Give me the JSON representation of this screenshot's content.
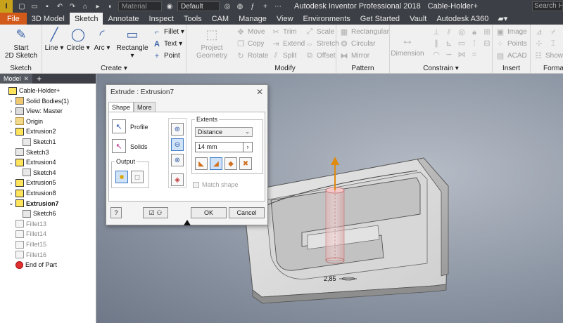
{
  "titlebar": {
    "logo": "I",
    "material_placeholder": "Material",
    "appearance_value": "Default",
    "title": "Autodesk Inventor Professional 2018",
    "document": "Cable-Holder+",
    "search_placeholder": "Search Help"
  },
  "tabs": [
    "File",
    "3D Model",
    "Sketch",
    "Annotate",
    "Inspect",
    "Tools",
    "CAM",
    "Manage",
    "View",
    "Environments",
    "Get Started",
    "Vault",
    "Autodesk A360"
  ],
  "active_tab": "Sketch",
  "ribbon": {
    "sketch_group": {
      "start_label": "Start\n2D Sketch",
      "group_label": "Sketch"
    },
    "create_group": {
      "line": "Line",
      "circle": "Circle",
      "arc": "Arc",
      "rectangle": "Rectangle",
      "fillet": "Fillet",
      "text": "Text",
      "point": "Point",
      "group_label": "Create"
    },
    "project_geometry": "Project\nGeometry",
    "modify_group": {
      "move": "Move",
      "copy": "Copy",
      "rotate": "Rotate",
      "trim": "Trim",
      "extend": "Extend",
      "split": "Split",
      "scale": "Scale",
      "stretch": "Stretch",
      "offset": "Offset",
      "group_label": "Modify"
    },
    "pattern_group": {
      "rectangular": "Rectangular",
      "circular": "Circular",
      "mirror": "Mirror",
      "group_label": "Pattern"
    },
    "constrain_group": {
      "dimension": "Dimension",
      "group_label": "Constrain"
    },
    "insert_group": {
      "image": "Image",
      "points": "Points",
      "acad": "ACAD",
      "group_label": "Insert"
    },
    "format_group": {
      "show_format": "Show F",
      "group_label": "Format"
    }
  },
  "browser": {
    "tab": "Model",
    "items": [
      {
        "label": "Cable-Holder+",
        "icon": "part-icon",
        "twisty": "",
        "indent": 0,
        "style": ""
      },
      {
        "label": "Solid Bodies(1)",
        "icon": "solid-bodies-icon",
        "twisty": "›",
        "indent": 1,
        "style": ""
      },
      {
        "label": "View: Master",
        "icon": "view-icon",
        "twisty": "›",
        "indent": 1,
        "style": ""
      },
      {
        "label": "Origin",
        "icon": "folder-icon",
        "twisty": "›",
        "indent": 1,
        "style": ""
      },
      {
        "label": "Extrusion2",
        "icon": "extrusion-icon",
        "twisty": "⌄",
        "indent": 1,
        "style": ""
      },
      {
        "label": "Sketch1",
        "icon": "sketch-icon",
        "twisty": "",
        "indent": 2,
        "style": ""
      },
      {
        "label": "Sketch3",
        "icon": "sketch-icon",
        "twisty": "",
        "indent": 1,
        "style": ""
      },
      {
        "label": "Extrusion4",
        "icon": "extrusion-icon",
        "twisty": "⌄",
        "indent": 1,
        "style": ""
      },
      {
        "label": "Sketch4",
        "icon": "sketch-icon",
        "twisty": "",
        "indent": 2,
        "style": ""
      },
      {
        "label": "Extrusion5",
        "icon": "extrusion-icon",
        "twisty": "›",
        "indent": 1,
        "style": ""
      },
      {
        "label": "Extrusion8",
        "icon": "extrusion-icon",
        "twisty": "›",
        "indent": 1,
        "style": ""
      },
      {
        "label": "Extrusion7",
        "icon": "extrusion-icon",
        "twisty": "⌄",
        "indent": 1,
        "style": "bold"
      },
      {
        "label": "Sketch6",
        "icon": "sketch-icon",
        "twisty": "",
        "indent": 2,
        "style": ""
      },
      {
        "label": "Fillet13",
        "icon": "fillet-icon",
        "twisty": "",
        "indent": 1,
        "style": "grey"
      },
      {
        "label": "Fillet14",
        "icon": "fillet-icon",
        "twisty": "",
        "indent": 1,
        "style": "grey"
      },
      {
        "label": "Fillet15",
        "icon": "fillet-icon",
        "twisty": "",
        "indent": 1,
        "style": "grey"
      },
      {
        "label": "Fillet16",
        "icon": "fillet-icon",
        "twisty": "",
        "indent": 1,
        "style": "grey"
      },
      {
        "label": "End of Part",
        "icon": "end-of-part-icon",
        "twisty": "",
        "indent": 1,
        "style": ""
      }
    ]
  },
  "dialog": {
    "title": "Extrude : Extrusion7",
    "tabs": [
      "Shape",
      "More"
    ],
    "profile_label": "Profile",
    "solids_label": "Solids",
    "output_label": "Output",
    "extents_label": "Extents",
    "extents_value": "Distance",
    "distance_value": "14 mm",
    "match_shape_label": "Match shape",
    "ok_label": "OK",
    "cancel_label": "Cancel"
  },
  "viewport": {
    "dimension_label": "2,85"
  },
  "colors": {
    "file_tab": "#d25b1c",
    "titlebar": "#3c3f45",
    "accent": "#3a62a8",
    "arrow": "#e08a10"
  }
}
